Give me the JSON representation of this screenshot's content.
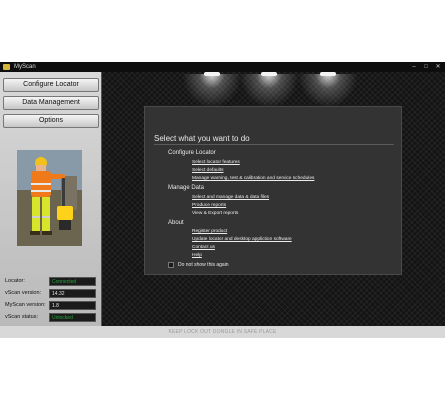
{
  "window": {
    "title": "MyScan",
    "minimize": "–",
    "maximize": "□",
    "close": "✕"
  },
  "sidebar": {
    "buttons": [
      "Configure Locator",
      "Data Management",
      "Options"
    ],
    "status": [
      {
        "label": "Locator:",
        "value": "Connected"
      },
      {
        "label": "vScan version:",
        "value": "14.32"
      },
      {
        "label": "MyScan version:",
        "value": "1.8"
      },
      {
        "label": "vScan status:",
        "value": "Unlocked"
      }
    ]
  },
  "main": {
    "heading": "Select what you want to do",
    "sections": [
      {
        "title": "Configure Locator",
        "links": [
          "Select locator features",
          "Select defaults",
          "Manage warning, test & calibration and service schedules"
        ]
      },
      {
        "title": "Manage Data",
        "links": [
          "Select and manage data & data files",
          "Produce reports",
          "View & Export reports"
        ]
      },
      {
        "title": "About",
        "links": [
          "Register product",
          "Update locator and desktop appliction software",
          "Contact us",
          "Help"
        ]
      }
    ],
    "checkbox_label": "Do not show this again"
  },
  "footer": {
    "text": "KEEP LOCK OUT DONGLE IN SAFE PLACE"
  },
  "colors": {
    "status_ok": "#2aa63c",
    "hi_vis": "#f07a1a"
  }
}
